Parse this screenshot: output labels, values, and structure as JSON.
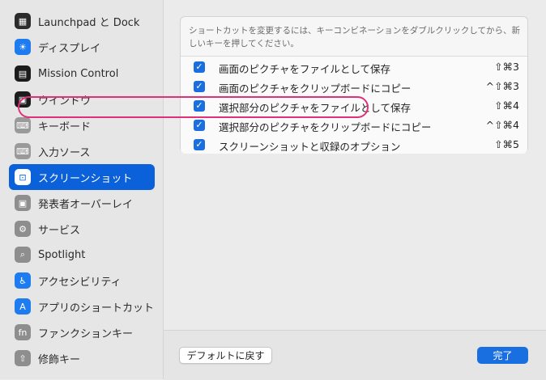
{
  "sidebar": {
    "items": [
      {
        "label": "Launchpad と Dock",
        "icon": "launchpad-dock-icon",
        "glyph": "▦",
        "color": "#2b2b2b"
      },
      {
        "label": "ディスプレイ",
        "icon": "display-icon",
        "glyph": "☀",
        "color": "#1e7cf0"
      },
      {
        "label": "Mission Control",
        "icon": "mission-control-icon",
        "glyph": "▤",
        "color": "#1c1c1c"
      },
      {
        "label": "ウインドウ",
        "icon": "window-icon",
        "glyph": "▣",
        "color": "#1c1c1c"
      },
      {
        "label": "キーボード",
        "icon": "keyboard-icon",
        "glyph": "⌨",
        "color": "#9a9a9a"
      },
      {
        "label": "入力ソース",
        "icon": "input-source-icon",
        "glyph": "⌨",
        "color": "#9a9a9a"
      },
      {
        "label": "スクリーンショット",
        "icon": "screenshot-icon",
        "glyph": "⊡",
        "color": "#ffffff"
      },
      {
        "label": "発表者オーバーレイ",
        "icon": "presenter-overlay-icon",
        "glyph": "▣",
        "color": "#8e8e8e"
      },
      {
        "label": "サービス",
        "icon": "services-icon",
        "glyph": "⚙",
        "color": "#8e8e8e"
      },
      {
        "label": "Spotlight",
        "icon": "spotlight-icon",
        "glyph": "⌕",
        "color": "#8e8e8e"
      },
      {
        "label": "アクセシビリティ",
        "icon": "accessibility-icon",
        "glyph": "♿",
        "color": "#1e7cf0"
      },
      {
        "label": "アプリのショートカット",
        "icon": "app-shortcuts-icon",
        "glyph": "A",
        "color": "#1e7cf0"
      },
      {
        "label": "ファンクションキー",
        "icon": "function-keys-icon",
        "glyph": "fn",
        "color": "#8e8e8e"
      },
      {
        "label": "修飾キー",
        "icon": "modifier-keys-icon",
        "glyph": "⇧",
        "color": "#8e8e8e"
      }
    ],
    "active_index": 6,
    "accent": "#0a61d9"
  },
  "main": {
    "instructions": "ショートカットを変更するには、キーコンビネーションをダブルクリックしてから、新しいキーを押してください。",
    "shortcuts": [
      {
        "label": "画面のピクチャをファイルとして保存",
        "keys": "⇧⌘3",
        "checked": true
      },
      {
        "label": "画面のピクチャをクリップボードにコピー",
        "keys": "^⇧⌘3",
        "checked": true
      },
      {
        "label": "選択部分のピクチャをファイルとして保存",
        "keys": "⇧⌘4",
        "checked": true
      },
      {
        "label": "選択部分のピクチャをクリップボードにコピー",
        "keys": "^⇧⌘4",
        "checked": true
      },
      {
        "label": "スクリーンショットと収録のオプション",
        "keys": "⇧⌘5",
        "checked": true
      }
    ],
    "highlighted_index": 2,
    "highlight_color": "#e0307a",
    "check_glyph": "✓"
  },
  "footer": {
    "default_button": "デフォルトに戻す",
    "done_button": "完了"
  }
}
